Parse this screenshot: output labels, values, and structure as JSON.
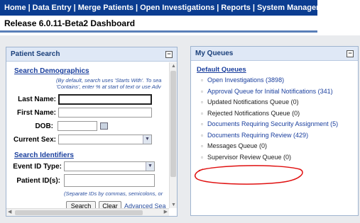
{
  "nav": {
    "items": [
      "Home",
      "Data Entry",
      "Merge Patients",
      "Open Investigations",
      "Reports",
      "System Management"
    ],
    "separator": "|"
  },
  "release_title": "Release 6.0.11-Beta2 Dashboard",
  "patient_search": {
    "title": "Patient Search",
    "collapse_symbol": "−",
    "demographics": {
      "heading": "Search Demographics",
      "hint_line1": "(By default, search uses 'Starts With'. To sea",
      "hint_line2": "'Contains', enter % at start of text or use Adv",
      "last_name_label": "Last Name:",
      "first_name_label": "First Name:",
      "dob_label": "DOB:",
      "current_sex_label": "Current Sex:"
    },
    "identifiers": {
      "heading": "Search Identifiers",
      "event_id_type_label": "Event ID Type:",
      "patient_ids_label": "Patient ID(s):",
      "hint": "(Separate IDs by commas, semicolons, or"
    },
    "buttons": {
      "search": "Search",
      "clear": "Clear",
      "advanced": "Advanced Sea"
    }
  },
  "my_queues": {
    "title": "My Queues",
    "collapse_symbol": "−",
    "heading": "Default Queues",
    "items": [
      {
        "label": "Open Investigations (3898)",
        "link": true
      },
      {
        "label": "Approval Queue for Initial Notifications (341)",
        "link": true
      },
      {
        "label": "Updated Notifications Queue (0)",
        "link": false
      },
      {
        "label": "Rejected Notifications Queue (0)",
        "link": false
      },
      {
        "label": "Documents Requiring Security Assignment (5)",
        "link": true
      },
      {
        "label": "Documents Requiring Review (429)",
        "link": true
      },
      {
        "label": "Messages Queue (0)",
        "link": false
      },
      {
        "label": "Supervisor Review Queue (0)",
        "link": false
      }
    ]
  },
  "colors": {
    "nav_bg": "#0b3d91",
    "link": "#1a3f9e",
    "annotation": "#e01010"
  }
}
